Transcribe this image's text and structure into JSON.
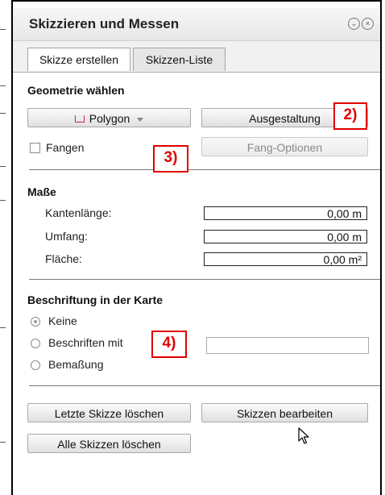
{
  "panel": {
    "title": "Skizzieren und Messen",
    "icons": [
      "collapse-icon",
      "close-icon"
    ],
    "icon_glyphs": {
      "collapse": "⌄",
      "close": "×"
    }
  },
  "tabs": [
    {
      "label": "Skizze erstellen",
      "active": true
    },
    {
      "label": "Skizzen-Liste",
      "active": false
    }
  ],
  "geometry": {
    "title": "Geometrie wählen",
    "polygon_label": "Polygon",
    "polygon_icon_color": "#d9263a",
    "style_button": "Ausgestaltung",
    "snap_label": "Fangen",
    "snap_checked": false,
    "snap_options_button": "Fang-Optionen"
  },
  "measures": {
    "title": "Maße",
    "rows": [
      {
        "label": "Kantenlänge:",
        "value": "0,00 m"
      },
      {
        "label": "Umfang:",
        "value": "0,00 m"
      },
      {
        "label": "Fläche:",
        "value": "0,00 m²"
      }
    ]
  },
  "labeling": {
    "title": "Beschriftung in der Karte",
    "options": [
      {
        "label": "Keine",
        "selected": true
      },
      {
        "label": "Beschriften mit",
        "selected": false
      },
      {
        "label": "Bemaßung",
        "selected": false
      }
    ],
    "text_value": ""
  },
  "actions": {
    "delete_last": "Letzte Skizze löschen",
    "edit": "Skizzen bearbeiten",
    "delete_all": "Alle Skizzen löschen"
  },
  "callouts": [
    "2)",
    "3)",
    "4)"
  ],
  "colors": {
    "callout": "#e00000",
    "separator": "#7a7a7a"
  }
}
